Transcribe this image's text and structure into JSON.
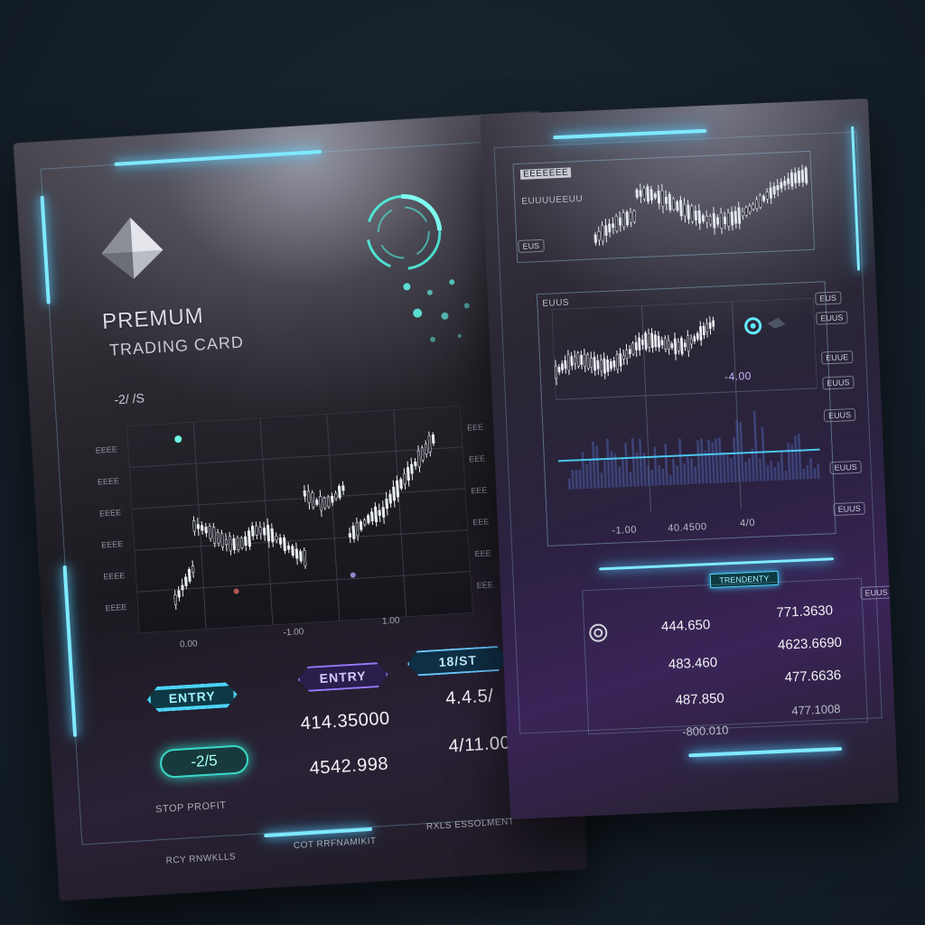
{
  "left_card": {
    "title_line1": "PREMUM",
    "title_line2": "TRADING CARD",
    "ratio_label": "-2/ /S",
    "tags": {
      "entry_1": "ENTRY",
      "entry_2": "ENTRY",
      "best": "18/ST"
    },
    "pill_value": "-2/5",
    "values": {
      "v1": "414.35000",
      "v2": "4542.998",
      "v3": "4.4.5/",
      "v4": "4/11.00"
    },
    "labels": {
      "stop_profit": "STOP PROFIT",
      "bottom_left": "RCY RNWKLLS",
      "bottom_mid": "COT RRFNAMIKIT",
      "bottom_right": "RXLS ESSOLMENT"
    },
    "x_axis_labels": [
      "0.00",
      "-1.00",
      "1.00"
    ],
    "colors": {
      "accent": "#7fe9ff",
      "purple": "#9a78ff",
      "teal": "#3ad7c8"
    }
  },
  "right_card": {
    "top_panel": {
      "header": "EEEEEEE",
      "sub": "EUUUUEEUU",
      "side_badge": "EUS"
    },
    "middle_panel": {
      "header": "EUUS",
      "price_label": "-4.00",
      "x_labels": [
        "-1.00",
        "40.4500",
        "4/0"
      ]
    },
    "side_badges": [
      "EUS",
      "EUUS",
      "EUUE",
      "EUUS",
      "EUUS",
      "EUUS",
      "EUUS"
    ],
    "tag": "TRENDENTY",
    "small_tag": "EUUS",
    "values_left": [
      "444.650",
      "483.460",
      "487.850",
      "-800.010"
    ],
    "values_right": [
      "771.3630",
      "4623.6690",
      "477.6636",
      "477.1008"
    ]
  }
}
